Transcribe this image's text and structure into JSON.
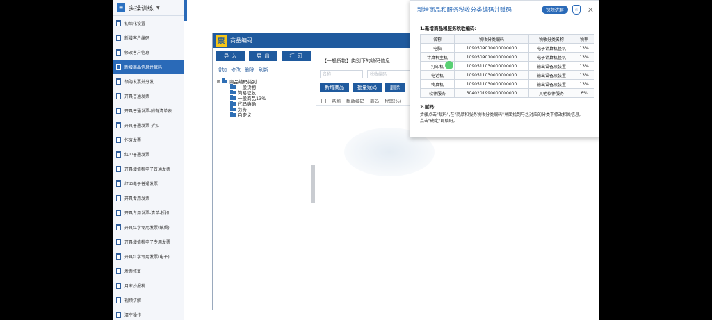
{
  "sidebar": {
    "title": "实操训练",
    "items": [
      "初始化设置",
      "新增客户编码",
      "修改客户信息",
      "新增商品信息并赋码",
      "领购发票并分发",
      "开具普通发票",
      "开具普通发票-附有清单表",
      "开具普通发票-折扣",
      "作废发票",
      "红冲普通发票",
      "开具增值税电子普通发票",
      "红冲电子普通发票",
      "开具专用发票",
      "开具专用发票-清单-折扣",
      "开具红字专用发票(纸质)",
      "开具增值税电子专用发票",
      "开具红字专用发票(电子)",
      "发票修复",
      "月末抄报税",
      "视频讲解",
      "清空操作"
    ],
    "active_index": 3
  },
  "window": {
    "logo": "票",
    "title": "商品编码",
    "buttons": [
      "导 入",
      "导 出",
      "打 印"
    ],
    "links": [
      "增加",
      "修改",
      "删除",
      "刷新"
    ],
    "tree": {
      "root": "商品编码类别",
      "children": [
        "一般货物",
        "简易征收",
        "一般商品13%",
        "代码确确",
        "劳务",
        "自定义"
      ]
    },
    "heading": "【一般货物】类别下的编码信息",
    "filters": {
      "name_placeholder": "名称",
      "code_placeholder": "税收编码"
    },
    "actions": [
      "新增商品",
      "批量赋码",
      "删除"
    ],
    "grid_columns": [
      "名称",
      "税收编码",
      "简码",
      "税率(%)"
    ]
  },
  "popup": {
    "title": "新增商品和服务税收分类编码并赋码",
    "video_label": "视频讲解",
    "section1": "1.新增商品和服务税收编码:",
    "columns": [
      "名称",
      "税收分类编码",
      "税收分类名称",
      "税率"
    ],
    "rows": [
      [
        "电脑",
        "1090509010000000000",
        "电子计算机整机",
        "13%"
      ],
      [
        "计算机主机",
        "1090509010000000000",
        "电子计算机整机",
        "13%"
      ],
      [
        "打印机",
        "1090511030000000000",
        "输出设备及装置",
        "13%"
      ],
      [
        "电话机",
        "1090511030000000000",
        "输出设备及装置",
        "13%"
      ],
      [
        "传真机",
        "1090511030000000000",
        "输出设备及装置",
        "13%"
      ],
      [
        "软件服务",
        "3040201990000000000",
        "其他软件服务",
        "6%"
      ]
    ],
    "section2": "2.赋码:",
    "desc_line1": "步骤点击\"赋码\",在\"商品和服务税收分类编码\"界面找到与之对应的分类下修改相关信息,",
    "desc_line2": "点击\"确定\"即赋码。"
  }
}
